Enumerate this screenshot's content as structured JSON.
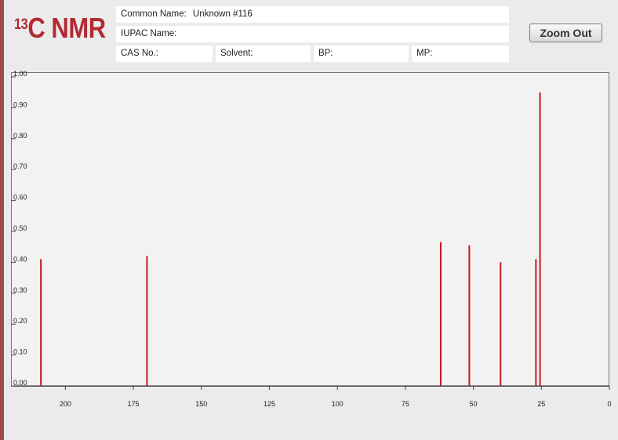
{
  "header": {
    "title_sup": "13",
    "title_main": "C NMR"
  },
  "fields": {
    "common_name_label": "Common Name:",
    "common_name_value": "Unknown #116",
    "iupac_label": "IUPAC Name:",
    "iupac_value": "",
    "cas_label": "CAS No.:",
    "cas_value": "",
    "solvent_label": "Solvent:",
    "solvent_value": "",
    "bp_label": "BP:",
    "bp_value": "",
    "mp_label": "MP:",
    "mp_value": ""
  },
  "toolbar": {
    "zoom_out_label": "Zoom Out"
  },
  "chart_data": {
    "type": "bar",
    "peak_color": "#c41a1a",
    "x": [
      209,
      170,
      62,
      51.5,
      40,
      27,
      25.5
    ],
    "values": [
      0.41,
      0.42,
      0.465,
      0.455,
      0.4,
      0.41,
      0.95
    ],
    "xlim": [
      220,
      0
    ],
    "ylim": [
      0,
      1.0
    ],
    "x_ticks": [
      200,
      175,
      150,
      125,
      100,
      75,
      50,
      25,
      0
    ],
    "x_tick_labels": [
      "200",
      "175",
      "150",
      "125",
      "100",
      "75",
      "50",
      "25",
      "0"
    ],
    "y_ticks": [
      0.0,
      0.1,
      0.2,
      0.3,
      0.4,
      0.5,
      0.6,
      0.7,
      0.8,
      0.9,
      1.0
    ],
    "y_tick_labels": [
      "0.00",
      "0.10",
      "0.20",
      "0.30",
      "0.40",
      "0.50",
      "0.60",
      "0.70",
      "0.80",
      "0.90",
      "1.00"
    ]
  }
}
